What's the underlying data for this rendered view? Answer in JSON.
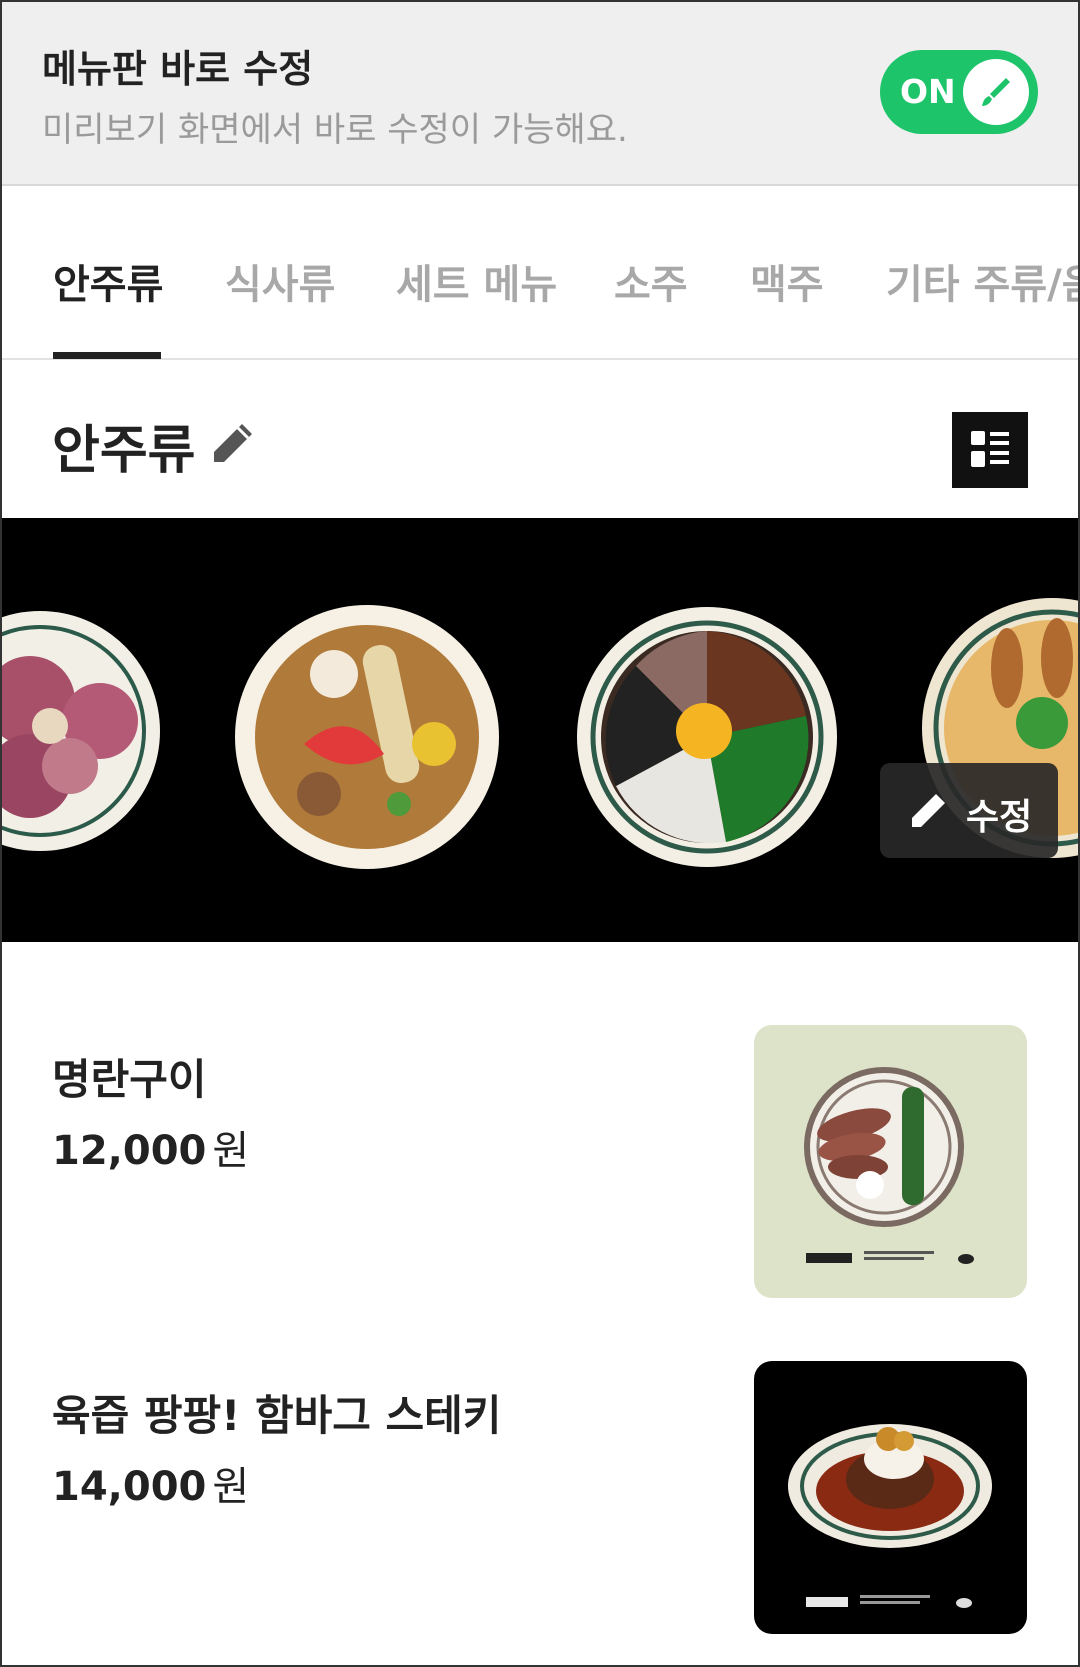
{
  "edit_bar": {
    "title": "메뉴판 바로 수정",
    "subtitle": "미리보기 화면에서 바로 수정이 가능해요.",
    "toggle_label": "ON",
    "toggle_color": "#1ec46a"
  },
  "tabs": [
    {
      "label": "안주류",
      "active": true
    },
    {
      "label": "식사류",
      "active": false
    },
    {
      "label": "세트 메뉴",
      "active": false
    },
    {
      "label": "소주",
      "active": false
    },
    {
      "label": "맥주",
      "active": false
    },
    {
      "label": "기타 주류/음",
      "active": false
    }
  ],
  "section": {
    "title": "안주류",
    "edit_icon": "pencil-icon",
    "view_icon": "list-view-icon"
  },
  "banner": {
    "edit_label": "수정"
  },
  "items": [
    {
      "name": "명란구이",
      "price": "12,000",
      "currency": "원",
      "image_bg": "#dde3c8"
    },
    {
      "name": "육즙 팡팡! 함바그 스테키",
      "price": "14,000",
      "currency": "원",
      "image_bg": "#000000"
    }
  ]
}
